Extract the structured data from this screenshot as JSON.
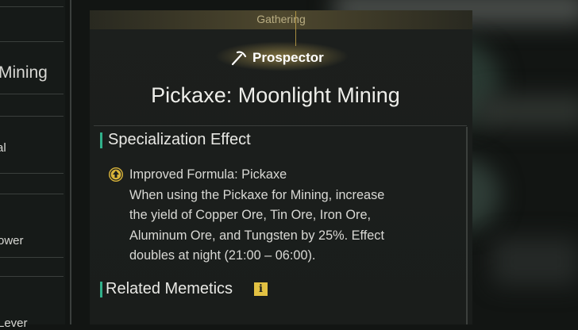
{
  "sidebar": {
    "items": [
      {
        "label": "Mining",
        "partial": true
      },
      {
        "label": "al",
        "partial": true
      },
      {
        "label": "ower",
        "partial": true
      },
      {
        "label": "Lever",
        "partial": true
      }
    ]
  },
  "detail": {
    "category": "Gathering",
    "profession": "Prospector",
    "profession_icon": "pickaxe-icon",
    "title": "Pickaxe: Moonlight Mining",
    "specialization": {
      "heading": "Specialization Effect",
      "icon": "upgrade-arrow-icon",
      "effect_name": "Improved Formula: Pickaxe",
      "description_lines": [
        "When using the Pickaxe for Mining, increase",
        "the yield of Copper Ore, Tin Ore, Iron Ore,",
        "Aluminum Ore, and Tungsten by 25%. Effect",
        "doubles at night (21:00 – 06:00)."
      ]
    },
    "related": {
      "heading": "Related Memetics",
      "icon": "info-icon",
      "icon_glyph": "i"
    }
  },
  "colors": {
    "accent_green": "#31b08a",
    "gold": "#d9b43a",
    "panel": "#1c1f1d"
  }
}
